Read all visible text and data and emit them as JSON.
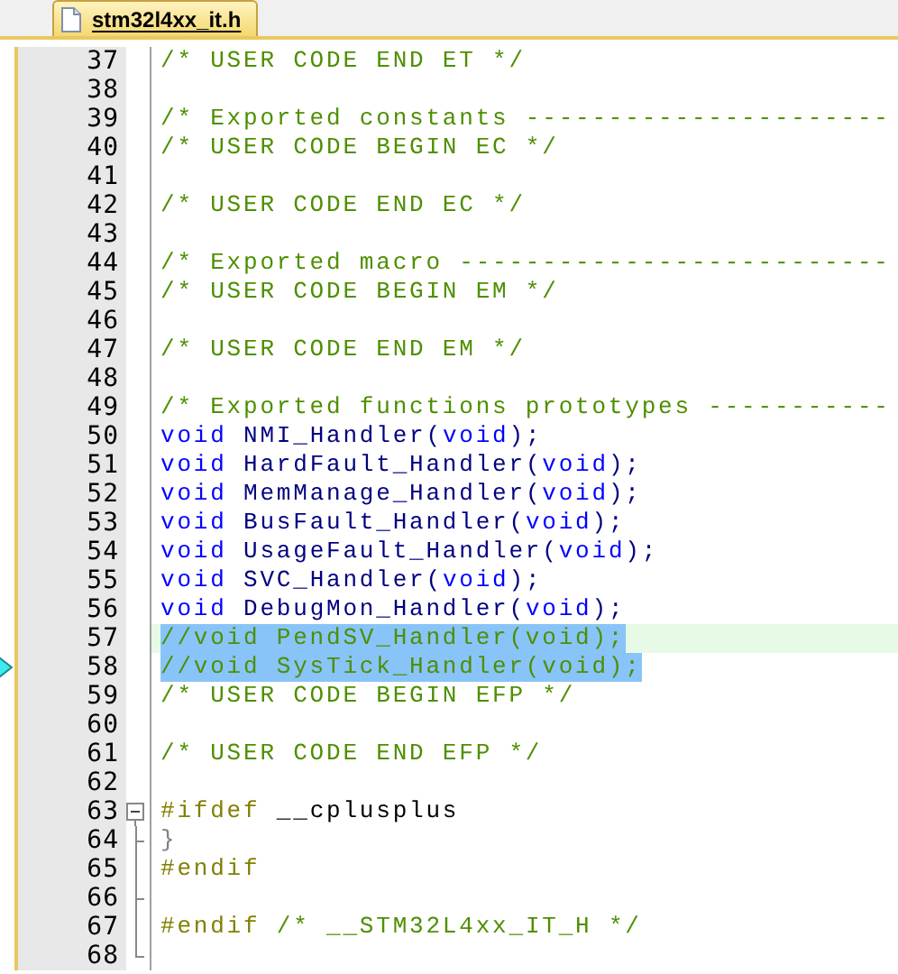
{
  "tab": {
    "label": "stm32l4xx_it.h",
    "selected": true
  },
  "lines": [
    {
      "number": "37",
      "kind": "plain",
      "selected": false,
      "current": false,
      "marker": false,
      "tokens": [
        {
          "kind": "comment",
          "text": "/* USER CODE END ET */"
        }
      ]
    },
    {
      "number": "38",
      "kind": "plain",
      "selected": false,
      "current": false,
      "marker": false
    },
    {
      "number": "39",
      "kind": "plain",
      "selected": false,
      "current": false,
      "marker": false,
      "tokens": [
        {
          "kind": "comment",
          "text": "/* Exported constants ----------------------"
        }
      ]
    },
    {
      "number": "40",
      "kind": "plain",
      "selected": false,
      "current": false,
      "marker": false,
      "tokens": [
        {
          "kind": "comment",
          "text": "/* USER CODE BEGIN EC */"
        }
      ]
    },
    {
      "number": "41",
      "kind": "plain",
      "selected": false,
      "current": false,
      "marker": false
    },
    {
      "number": "42",
      "kind": "plain",
      "selected": false,
      "current": false,
      "marker": false,
      "tokens": [
        {
          "kind": "comment",
          "text": "/* USER CODE END EC */"
        }
      ]
    },
    {
      "number": "43",
      "kind": "plain",
      "selected": false,
      "current": false,
      "marker": false
    },
    {
      "number": "44",
      "kind": "plain",
      "selected": false,
      "current": false,
      "marker": false,
      "tokens": [
        {
          "kind": "comment",
          "text": "/* Exported macro --------------------------"
        }
      ]
    },
    {
      "number": "45",
      "kind": "plain",
      "selected": false,
      "current": false,
      "marker": false,
      "tokens": [
        {
          "kind": "comment",
          "text": "/* USER CODE BEGIN EM */"
        }
      ]
    },
    {
      "number": "46",
      "kind": "plain",
      "selected": false,
      "current": false,
      "marker": false
    },
    {
      "number": "47",
      "kind": "plain",
      "selected": false,
      "current": false,
      "marker": false,
      "tokens": [
        {
          "kind": "comment",
          "text": "/* USER CODE END EM */"
        }
      ]
    },
    {
      "number": "48",
      "kind": "plain",
      "selected": false,
      "current": false,
      "marker": false
    },
    {
      "number": "49",
      "kind": "plain",
      "selected": false,
      "current": false,
      "marker": false,
      "tokens": [
        {
          "kind": "comment",
          "text": "/* Exported functions prototypes -----------"
        }
      ]
    },
    {
      "number": "50",
      "kind": "plain",
      "selected": false,
      "current": false,
      "marker": false,
      "tokens": [
        {
          "kind": "keyword",
          "text": "void"
        },
        {
          "kind": "ident",
          "text": " NMI_Handler"
        },
        {
          "kind": "punct",
          "text": "("
        },
        {
          "kind": "keyword",
          "text": "void"
        },
        {
          "kind": "punct",
          "text": ");"
        }
      ]
    },
    {
      "number": "51",
      "kind": "plain",
      "selected": false,
      "current": false,
      "marker": false,
      "tokens": [
        {
          "kind": "keyword",
          "text": "void"
        },
        {
          "kind": "ident",
          "text": " HardFault_Handler"
        },
        {
          "kind": "punct",
          "text": "("
        },
        {
          "kind": "keyword",
          "text": "void"
        },
        {
          "kind": "punct",
          "text": ");"
        }
      ]
    },
    {
      "number": "52",
      "kind": "plain",
      "selected": false,
      "current": false,
      "marker": false,
      "tokens": [
        {
          "kind": "keyword",
          "text": "void"
        },
        {
          "kind": "ident",
          "text": " MemManage_Handler"
        },
        {
          "kind": "punct",
          "text": "("
        },
        {
          "kind": "keyword",
          "text": "void"
        },
        {
          "kind": "punct",
          "text": ");"
        }
      ]
    },
    {
      "number": "53",
      "kind": "plain",
      "selected": false,
      "current": false,
      "marker": false,
      "tokens": [
        {
          "kind": "keyword",
          "text": "void"
        },
        {
          "kind": "ident",
          "text": " BusFault_Handler"
        },
        {
          "kind": "punct",
          "text": "("
        },
        {
          "kind": "keyword",
          "text": "void"
        },
        {
          "kind": "punct",
          "text": ");"
        }
      ]
    },
    {
      "number": "54",
      "kind": "plain",
      "selected": false,
      "current": false,
      "marker": false,
      "tokens": [
        {
          "kind": "keyword",
          "text": "void"
        },
        {
          "kind": "ident",
          "text": " UsageFault_Handler"
        },
        {
          "kind": "punct",
          "text": "("
        },
        {
          "kind": "keyword",
          "text": "void"
        },
        {
          "kind": "punct",
          "text": ");"
        }
      ]
    },
    {
      "number": "55",
      "kind": "plain",
      "selected": false,
      "current": false,
      "marker": false,
      "tokens": [
        {
          "kind": "keyword",
          "text": "void"
        },
        {
          "kind": "ident",
          "text": " SVC_Handler"
        },
        {
          "kind": "punct",
          "text": "("
        },
        {
          "kind": "keyword",
          "text": "void"
        },
        {
          "kind": "punct",
          "text": ");"
        }
      ]
    },
    {
      "number": "56",
      "kind": "plain",
      "selected": false,
      "current": false,
      "marker": false,
      "tokens": [
        {
          "kind": "keyword",
          "text": "void"
        },
        {
          "kind": "ident",
          "text": " DebugMon_Handler"
        },
        {
          "kind": "punct",
          "text": "("
        },
        {
          "kind": "keyword",
          "text": "void"
        },
        {
          "kind": "punct",
          "text": ");"
        }
      ]
    },
    {
      "number": "57",
      "kind": "plain",
      "selected": true,
      "current": true,
      "marker": false,
      "tokens": [
        {
          "kind": "comment",
          "text": "//void PendSV_Handler(void);"
        }
      ]
    },
    {
      "number": "58",
      "kind": "plain",
      "selected": true,
      "current": false,
      "marker": true,
      "tokens": [
        {
          "kind": "comment",
          "text": "//void SysTick_Handler(void);"
        }
      ]
    },
    {
      "number": "59",
      "kind": "plain",
      "selected": false,
      "current": false,
      "marker": false,
      "tokens": [
        {
          "kind": "comment",
          "text": "/* USER CODE BEGIN EFP */"
        }
      ]
    },
    {
      "number": "60",
      "kind": "plain",
      "selected": false,
      "current": false,
      "marker": false
    },
    {
      "number": "61",
      "kind": "plain",
      "selected": false,
      "current": false,
      "marker": false,
      "tokens": [
        {
          "kind": "comment",
          "text": "/* USER CODE END EFP */"
        }
      ]
    },
    {
      "number": "62",
      "kind": "plain",
      "selected": false,
      "current": false,
      "marker": false
    },
    {
      "number": "63",
      "kind": "fold_start",
      "selected": false,
      "current": false,
      "marker": false,
      "tokens": [
        {
          "kind": "preproc",
          "text": "#ifdef"
        },
        {
          "kind": "plain",
          "text": " __cplusplus"
        }
      ]
    },
    {
      "number": "64",
      "kind": "fold_branch",
      "selected": false,
      "current": false,
      "marker": false,
      "tokens": [
        {
          "kind": "brace",
          "text": "}"
        }
      ]
    },
    {
      "number": "65",
      "kind": "fold_line",
      "selected": false,
      "current": false,
      "marker": false,
      "tokens": [
        {
          "kind": "preproc",
          "text": "#endif"
        }
      ]
    },
    {
      "number": "66",
      "kind": "fold_branch",
      "selected": false,
      "current": false,
      "marker": false
    },
    {
      "number": "67",
      "kind": "fold_line",
      "selected": false,
      "current": false,
      "marker": false,
      "tokens": [
        {
          "kind": "preproc",
          "text": "#endif"
        },
        {
          "kind": "comment",
          "text": " /* __STM32L4xx_IT_H */"
        }
      ]
    },
    {
      "number": "68",
      "kind": "fold_end",
      "selected": false,
      "current": false,
      "marker": false
    }
  ]
}
